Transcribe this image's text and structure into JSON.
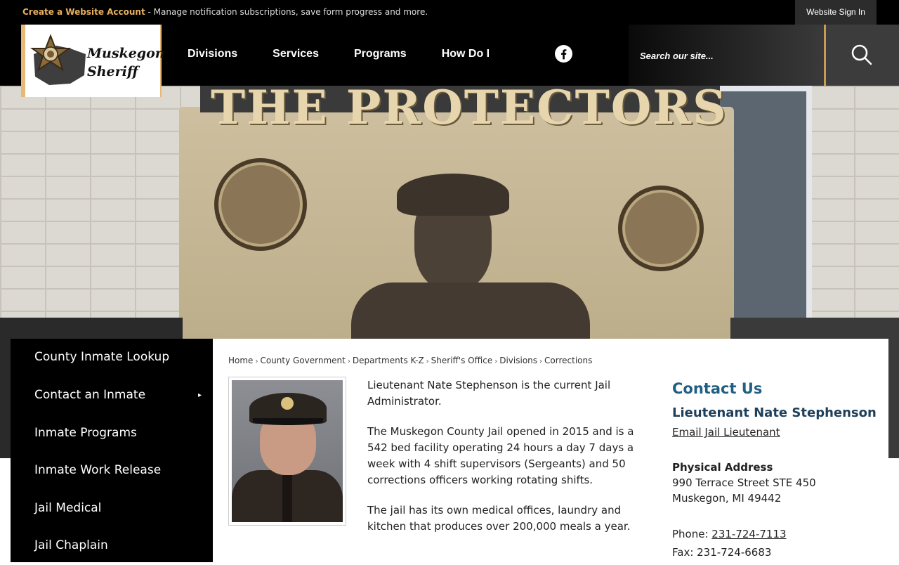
{
  "topbar": {
    "create_account": "Create a Website Account",
    "notice_text": " - Manage notification subscriptions, save form progress and more.",
    "sign_in": "Website Sign In"
  },
  "logo": {
    "line1": "Muskegon",
    "line2": "Sheriff"
  },
  "nav": {
    "items": [
      "Divisions",
      "Services",
      "Programs",
      "How Do I"
    ]
  },
  "search": {
    "placeholder": "Search our site..."
  },
  "hero": {
    "inscription": "THE PROTECTORS"
  },
  "sidebar": {
    "items": [
      {
        "label": "County Inmate Lookup"
      },
      {
        "label": "Contact an Inmate",
        "arrow": "▸"
      },
      {
        "label": "Inmate Programs"
      },
      {
        "label": "Inmate Work Release"
      },
      {
        "label": "Jail Medical"
      },
      {
        "label": "Jail Chaplain"
      }
    ]
  },
  "breadcrumb": {
    "items": [
      "Home",
      "County Government",
      "Departments K-Z",
      "Sheriff's Office",
      "Divisions",
      "Corrections"
    ],
    "separator": "›"
  },
  "main": {
    "paragraphs": [
      "Lieutenant Nate Stephenson is the current Jail Administrator.",
      "The Muskegon County Jail opened in 2015 and is a 542 bed facility operating 24 hours a day 7 days a week with 4 shift supervisors (Sergeants) and 50 corrections officers working rotating shifts.",
      "The jail has its own medical offices, laundry and kitchen that produces over 200,000 meals a year."
    ]
  },
  "contact": {
    "heading": "Contact Us",
    "name": "Lieutenant Nate Stephenson",
    "email_link": "Email Jail Lieutenant",
    "address_label": "Physical Address",
    "address_line1": "990 Terrace Street STE 450",
    "address_line2": "Muskegon, MI 49442",
    "phone_label": "Phone: ",
    "phone": "231-724-7113",
    "fax": "Fax: 231-724-6683"
  },
  "colors": {
    "accent_gold": "#e7b05d",
    "contact_heading": "#1f5f83",
    "header_bg": "#000000"
  }
}
